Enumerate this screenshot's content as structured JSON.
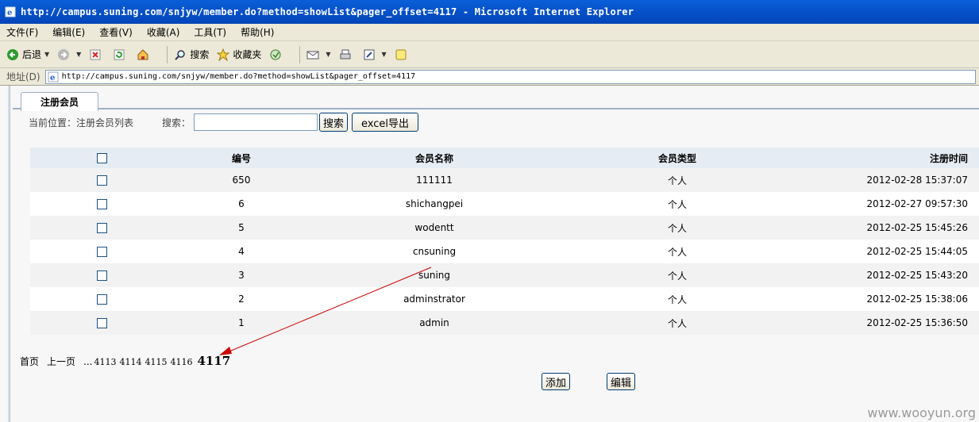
{
  "window": {
    "title": "http://campus.suning.com/snjyw/member.do?method=showList&pager_offset=4117 - Microsoft Internet Explorer"
  },
  "menu": [
    "文件(F)",
    "编辑(E)",
    "查看(V)",
    "收藏(A)",
    "工具(T)",
    "帮助(H)"
  ],
  "toolbar": {
    "back": "后退",
    "search": "搜索",
    "favorites": "收藏夹"
  },
  "address": {
    "label": "地址(D)",
    "url": "http://campus.suning.com/snjyw/member.do?method=showList&pager_offset=4117"
  },
  "page": {
    "tab": "注册会员",
    "location": "当前位置：注册会员列表",
    "search_label": "搜索：",
    "search_value": "",
    "search_button": "搜索",
    "export_button": "excel导出"
  },
  "table": {
    "headers": [
      "编号",
      "会员名称",
      "会员类型",
      "注册时间"
    ],
    "rows": [
      {
        "id": "650",
        "name": "111111",
        "type": "个人",
        "time": "2012-02-28 15:37:07"
      },
      {
        "id": "6",
        "name": "shichangpei",
        "type": "个人",
        "time": "2012-02-27 09:57:30"
      },
      {
        "id": "5",
        "name": "wodentt",
        "type": "个人",
        "time": "2012-02-25 15:45:26"
      },
      {
        "id": "4",
        "name": "cnsuning",
        "type": "个人",
        "time": "2012-02-25 15:44:05"
      },
      {
        "id": "3",
        "name": "suning",
        "type": "个人",
        "time": "2012-02-25 15:43:20"
      },
      {
        "id": "2",
        "name": "adminstrator",
        "type": "个人",
        "time": "2012-02-25 15:38:06"
      },
      {
        "id": "1",
        "name": "admin",
        "type": "个人",
        "time": "2012-02-25 15:36:50"
      }
    ]
  },
  "pager": {
    "first": "首页",
    "prev": "上一页",
    "ellipsis": "...",
    "pages": [
      "4113",
      "4114",
      "4115",
      "4116"
    ],
    "current": "4117"
  },
  "actions": {
    "add": "添加",
    "edit": "编辑"
  },
  "watermark": "www.wooyun.org",
  "colors": {
    "titlebar": "#0651c9",
    "chrome": "#ece9d8",
    "header_row": "#e6ecf3",
    "annotation_arrow": "#cc0000"
  }
}
